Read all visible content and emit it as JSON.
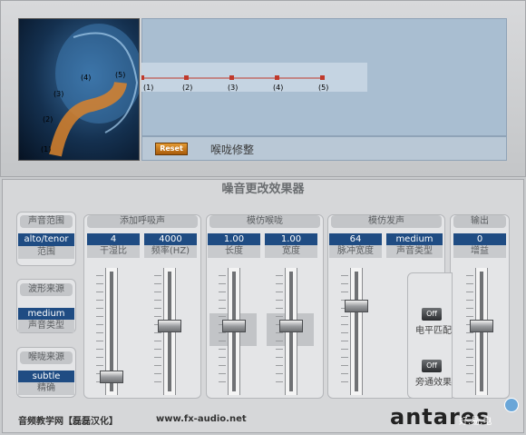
{
  "top": {
    "face_labels": [
      "(1)",
      "(2)",
      "(3)",
      "(4)",
      "(5)"
    ],
    "curve_point_labels": [
      "(1)",
      "(2)",
      "(3)",
      "(4)",
      "(5)"
    ],
    "reset_label": "Reset",
    "throat_label": "喉咙修整"
  },
  "main_title": "噪音更改效果器",
  "voice_range": {
    "title": "声音范围",
    "value": "alto/tenor",
    "sub": "范围"
  },
  "waveform": {
    "title": "波形来源",
    "value": "medium",
    "sub": "声音类型"
  },
  "throat_source": {
    "title": "喉咙来源",
    "value": "subtle",
    "sub": "精确"
  },
  "breath": {
    "title": "添加呼吸声",
    "dry_value": "4",
    "dry_sub": "干湿比",
    "freq_value": "4000",
    "freq_sub": "频率(HZ)",
    "dry_level": 0.1,
    "freq_level": 0.55
  },
  "throat_model": {
    "title": "模仿喉咙",
    "length_value": "1.00",
    "length_sub": "长度",
    "width_value": "1.00",
    "width_sub": "宽度",
    "length_level": 0.55,
    "width_level": 0.55
  },
  "glottal": {
    "title": "模仿发声",
    "pulse_value": "64",
    "pulse_sub": "脉冲宽度",
    "type_value": "medium",
    "type_sub": "声音类型",
    "pulse_level": 0.72
  },
  "output": {
    "title": "输出",
    "gain_value": "0",
    "gain_sub": "增益",
    "gain_level": 0.55
  },
  "level_match": {
    "button": "Off",
    "label": "电平匹配"
  },
  "bypass": {
    "button": "Off",
    "label": "旁通效果"
  },
  "footer": {
    "left": "音频教学网【磊磊汉化】",
    "url": "www.fx-audio.net",
    "brand": "antares",
    "watermark": "好.易.电"
  },
  "colors": {
    "value_bg": "#1f4c83",
    "curve_line": "#c0392b",
    "reset": "#c77a1c"
  }
}
